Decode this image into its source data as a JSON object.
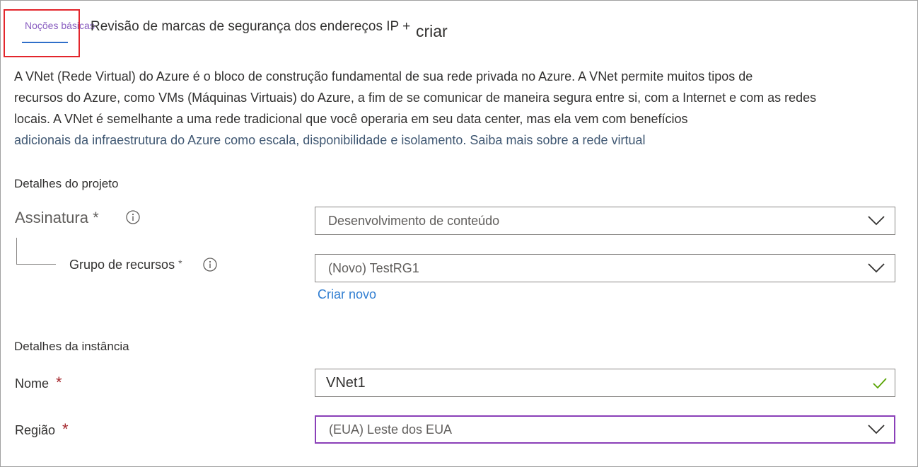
{
  "tabs": {
    "basics": "Noções básicas",
    "review": "Revisão de marcas de segurança dos endereços IP +",
    "create": "criar"
  },
  "description": {
    "line1": "A VNet (Rede Virtual) do Azure é o bloco de construção fundamental de sua rede privada no Azure. A VNet permite muitos tipos de",
    "line2": "recursos do Azure, como VMs (Máquinas Virtuais) do Azure, a fim de se comunicar de maneira segura entre si, com a Internet e com as redes",
    "line3": "locais. A VNet é semelhante a uma rede tradicional que você operaria em seu data center, mas ela vem com benefícios",
    "line4": "adicionais da infraestrutura do Azure como escala, disponibilidade e isolamento.",
    "learn_more": "Saiba mais sobre a rede virtual"
  },
  "project": {
    "title": "Detalhes do projeto",
    "subscription_label": "Assinatura",
    "subscription_required": "*",
    "subscription_value": "Desenvolvimento de conteúdo",
    "resource_group_label": "Grupo de recursos",
    "resource_group_required": "*",
    "resource_group_value": "(Novo) TestRG1",
    "create_new": "Criar novo"
  },
  "instance": {
    "title": "Detalhes da instância",
    "name_label": "Nome",
    "name_required": "*",
    "name_value": "VNet1",
    "region_label": "Região",
    "region_required": "*",
    "region_value": "(EUA) Leste dos EUA"
  },
  "colors": {
    "active_tab": "#8a5fc1",
    "tab_underline": "#2f6fc9",
    "highlight": "#e3262c",
    "link": "#2f7dd1",
    "required": "#a4262c",
    "valid_check": "#57a300",
    "focus_border": "#8a3fb8"
  },
  "icons": {
    "info": "info-icon",
    "chevron": "chevron-down-icon",
    "valid": "checkmark-icon"
  }
}
